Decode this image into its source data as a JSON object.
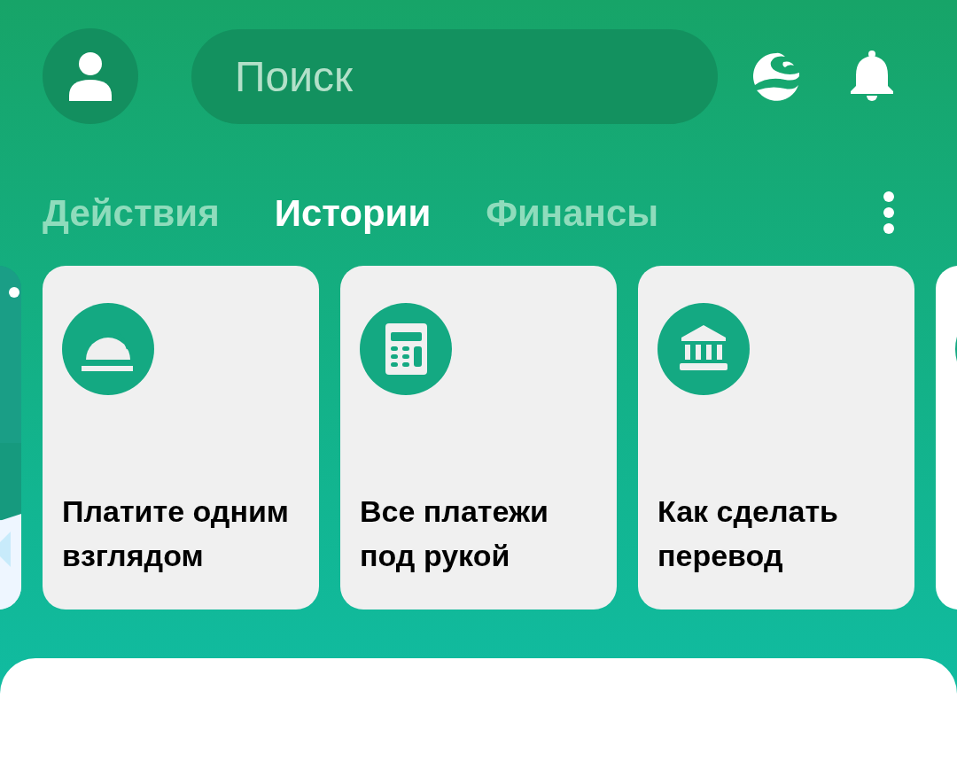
{
  "search": {
    "placeholder": "Поиск"
  },
  "tabs": [
    {
      "label": "Действия",
      "selected": false
    },
    {
      "label": "Истории",
      "selected": true
    },
    {
      "label": "Финансы",
      "selected": false
    }
  ],
  "cards": [
    {
      "kind": "picture"
    },
    {
      "kind": "story",
      "title": "Платите одним взглядом"
    },
    {
      "kind": "story",
      "title": "Все платежи под рукой"
    },
    {
      "kind": "story",
      "title": "Как сделать перевод"
    },
    {
      "kind": "peek"
    }
  ]
}
